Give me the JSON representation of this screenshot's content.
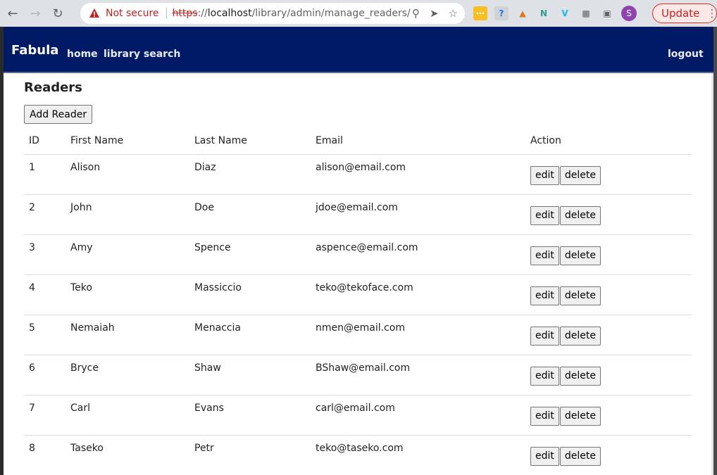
{
  "browser": {
    "security_label": "Not secure",
    "url_scheme": "https",
    "url_sep": "://",
    "url_host": "localhost",
    "url_path": "/library/admin/manage_readers/",
    "update_label": "Update",
    "avatar_letter": "S"
  },
  "navbar": {
    "brand": "Fabula",
    "home": "home",
    "search": "library search",
    "logout": "logout"
  },
  "main": {
    "title": "Readers",
    "add_button": "Add Reader",
    "columns": [
      "ID",
      "First Name",
      "Last Name",
      "Email",
      "Action"
    ],
    "edit_label": "edit",
    "delete_label": "delete",
    "rows": [
      {
        "id": "1",
        "first": "Alison",
        "last": "Diaz",
        "email": "alison@email.com"
      },
      {
        "id": "2",
        "first": "John",
        "last": "Doe",
        "email": "jdoe@email.com"
      },
      {
        "id": "3",
        "first": "Amy",
        "last": "Spence",
        "email": "aspence@email.com"
      },
      {
        "id": "4",
        "first": "Teko",
        "last": "Massiccio",
        "email": "teko@tekoface.com"
      },
      {
        "id": "5",
        "first": "Nemaiah",
        "last": "Menaccia",
        "email": "nmen@email.com"
      },
      {
        "id": "6",
        "first": "Bryce",
        "last": "Shaw",
        "email": "BShaw@email.com"
      },
      {
        "id": "7",
        "first": "Carl",
        "last": "Evans",
        "email": "carl@email.com"
      },
      {
        "id": "8",
        "first": "Taseko",
        "last": "Petr",
        "email": "teko@taseko.com"
      }
    ]
  },
  "colors": {
    "navbar_bg": "#001a66",
    "security_warning": "#c5221f"
  }
}
